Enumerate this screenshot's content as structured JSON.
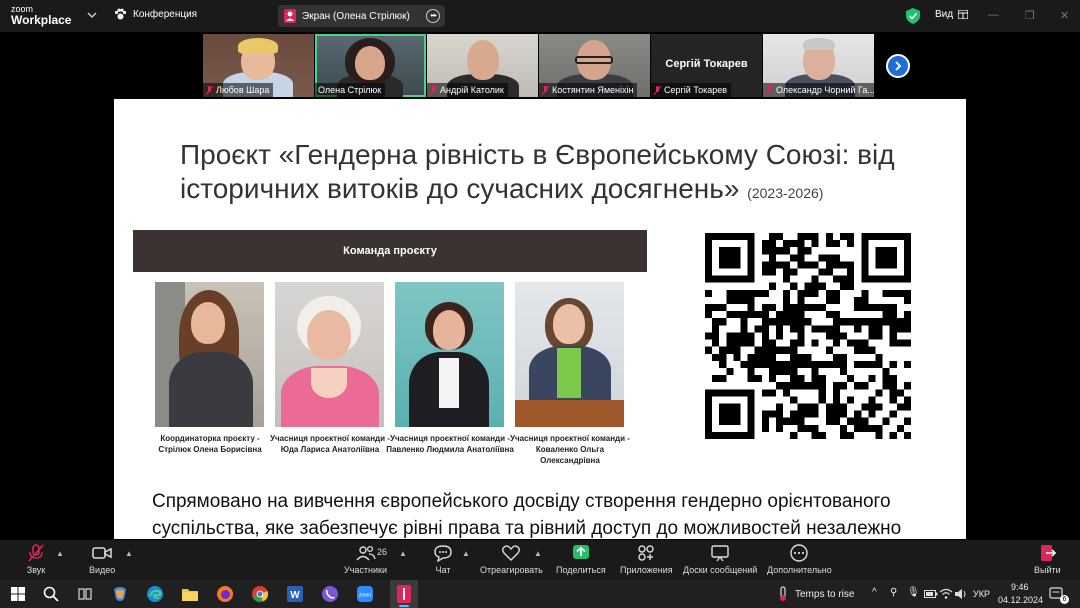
{
  "app": {
    "logo_line1": "zoom",
    "logo_line2": "Workplace",
    "conference_label": "Конференция"
  },
  "share": {
    "label": "Экран (Олена Стрілюк)"
  },
  "view": {
    "label": "Вид"
  },
  "participants": [
    {
      "name": "Любов Шара"
    },
    {
      "name": "Олена Стрілюк",
      "active": true
    },
    {
      "name": "Андрій Католик"
    },
    {
      "name": "Костянтин Яменіхін"
    },
    {
      "name": "Сергій Токарев",
      "display_text": "Сергій Токарев"
    },
    {
      "name": "Олександр Чорний Га..."
    }
  ],
  "slide": {
    "title_prefix": "Проєкт ",
    "title_main": "«Гендерна рівність в Європейському Союзі: від історичних витоків до сучасних досягнень»",
    "title_years": "(2023-2026)",
    "team_header": "Команда проєкту",
    "members": [
      {
        "caption": "Координаторка проєкту - Стрілюк Олена Борисівна"
      },
      {
        "caption": "Учасниця проєктної команди - Юда Лариса Анатоліївна"
      },
      {
        "caption": "Учасниця проєктної команди - Павленко Людмила Анатоліївна"
      },
      {
        "caption": "Учасниця проєктної команди - Коваленко Ольга Олександрівна"
      }
    ],
    "body_text": "Спрямовано на вивчення європейського досвіду створення гендерно орієнтованого суспільства, яке забезпечує рівні права та рівний доступ до можливостей незалежно"
  },
  "toolbar": {
    "audio": "Звук",
    "video": "Видео",
    "participants": "Участники",
    "participants_count": "26",
    "chat": "Чат",
    "react": "Отреагировать",
    "share": "Поделиться",
    "apps": "Приложения",
    "whiteboards": "Доски сообщений",
    "more": "Дополнительно",
    "leave": "Выйти"
  },
  "taskbar": {
    "weather": "Temps to rise",
    "lang": "УКР",
    "time": "9:46",
    "date": "04.12.2024",
    "notifications": "6"
  },
  "colors": {
    "accent_green": "#4ad28a",
    "zoom_blue": "#1d6fd8",
    "share_green": "#23c16b",
    "mic_red": "#e0245e",
    "slide_header": "#3a3331"
  }
}
